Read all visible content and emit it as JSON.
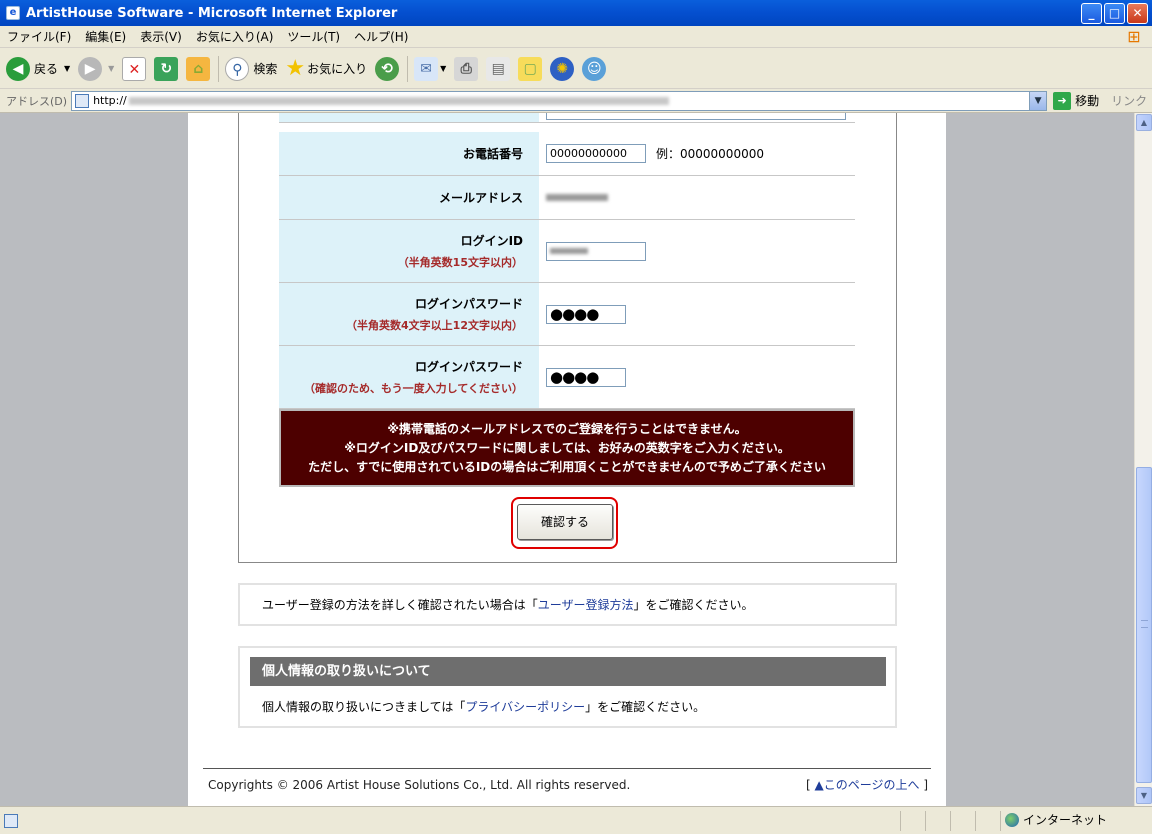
{
  "window": {
    "title": "ArtistHouse Software - Microsoft Internet Explorer",
    "minimize": "_",
    "maximize": "□",
    "close": "✕"
  },
  "menu": [
    "ファイル(F)",
    "編集(E)",
    "表示(V)",
    "お気に入り(A)",
    "ツール(T)",
    "ヘルプ(H)"
  ],
  "toolbar": {
    "back": "戻る",
    "search": "検索",
    "favorites": "お気に入り"
  },
  "address": {
    "label": "アドレス(D)",
    "url_prefix": "http://",
    "go": "移動",
    "links": "リンク"
  },
  "form": {
    "phone": {
      "label": "お電話番号",
      "value": "00000000000",
      "example": "例：00000000000"
    },
    "email": {
      "label": "メールアドレス"
    },
    "login_id": {
      "label": "ログインID",
      "note": "（半角英数15文字以内）"
    },
    "password": {
      "label": "ログインパスワード",
      "note": "（半角英数4文字以上12文字以内）",
      "value": "●●●●"
    },
    "password_confirm": {
      "label": "ログインパスワード",
      "note": "（確認のため、もう一度入力してください）",
      "value": "●●●●"
    },
    "notice": [
      "※携帯電話のメールアドレスでのご登録を行うことはできません。",
      "※ログインID及びパスワードに関しましては、お好みの英数字をご入力ください。",
      "ただし、すでに使用されているIDの場合はご利用頂くことができませんので予めご了承ください"
    ],
    "confirm_button": "確認する"
  },
  "help": {
    "before": "ユーザー登録の方法を詳しく確認されたい場合は「",
    "link": "ユーザー登録方法",
    "after": "」をご確認ください。"
  },
  "privacy": {
    "heading": "個人情報の取り扱いについて",
    "before": "個人情報の取り扱いにつきましては「",
    "link": "プライバシーポリシー",
    "after": "」をご確認ください。"
  },
  "footer": {
    "copyright": "Copyrights © 2006 Artist House Solutions Co., Ltd. All rights reserved.",
    "to_top": "▲このページの上へ",
    "bracket_open": "[ ",
    "bracket_close": " ]"
  },
  "status": {
    "zone": "インターネット"
  }
}
